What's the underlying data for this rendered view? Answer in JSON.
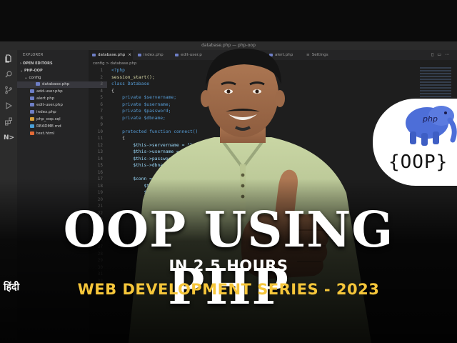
{
  "window": {
    "title": "database.php — php-oop"
  },
  "activity_bar": {
    "icons": [
      "files-icon",
      "search-icon",
      "source-control-icon",
      "run-debug-icon",
      "extensions-icon",
      "nx-icon"
    ]
  },
  "sidebar": {
    "header": "EXPLORER",
    "open_editors": "OPEN EDITORS",
    "project": "PHP-OOP",
    "folder": "config",
    "files": [
      {
        "name": "database.php",
        "color": "#6e7fc7",
        "selected": true
      },
      {
        "name": "add-user.php",
        "color": "#6e7fc7"
      },
      {
        "name": "alert.php",
        "color": "#6e7fc7"
      },
      {
        "name": "edit-user.php",
        "color": "#6e7fc7"
      },
      {
        "name": "index.php",
        "color": "#6e7fc7"
      },
      {
        "name": "php_oop.sql",
        "color": "#d8a03a"
      },
      {
        "name": "README.md",
        "color": "#4aa0d8"
      },
      {
        "name": "test.html",
        "color": "#e46b37"
      }
    ]
  },
  "tabs": [
    {
      "label": "database.php",
      "active": true
    },
    {
      "label": "index.php"
    },
    {
      "label": "edit-user.p"
    },
    {
      "label": "hp"
    },
    {
      "label": "alert.php"
    },
    {
      "label": "Settings"
    }
  ],
  "breadcrumb": "config > database.php",
  "code": {
    "line_numbers": [
      "1",
      "2",
      "3",
      "4",
      "5",
      "6",
      "7",
      "8",
      "9",
      "10",
      "11",
      "12",
      "13",
      "14",
      "15",
      "16",
      "17",
      "18",
      "19",
      "20",
      "21",
      "22",
      "23",
      "24",
      "25",
      "26",
      "27",
      "28",
      "29",
      "30",
      "31",
      "32"
    ],
    "lines": [
      "<?php",
      "session_start();",
      "class Database",
      "{",
      "    private $servername;",
      "    private $username;",
      "    private $password;",
      "    private $dbname;",
      "",
      "    protected function connect()",
      "    {",
      "        $this->servername = \"localh",
      "        $this->username = \"root\";",
      "        $this->password = \"\";",
      "        $this->dbname = \"p",
      "",
      "        $conn = new",
      "            $this",
      "            $thi",
      "            $th",
      "            $th",
      "        );"
    ]
  },
  "badge": {
    "text": "{OOP}",
    "elephant_label": "php"
  },
  "thumbnail": {
    "headline": "OOP USING PHP",
    "subline": "IN 2.5 HOURS",
    "series": "WEB DEVELOPMENT SERIES - 2023",
    "language": "हिंदी"
  },
  "colors": {
    "accent_yellow": "#f6c63a",
    "editor_bg": "#1e1e1e",
    "sidebar_bg": "#252526",
    "php_blue": "#4d6ed8"
  }
}
